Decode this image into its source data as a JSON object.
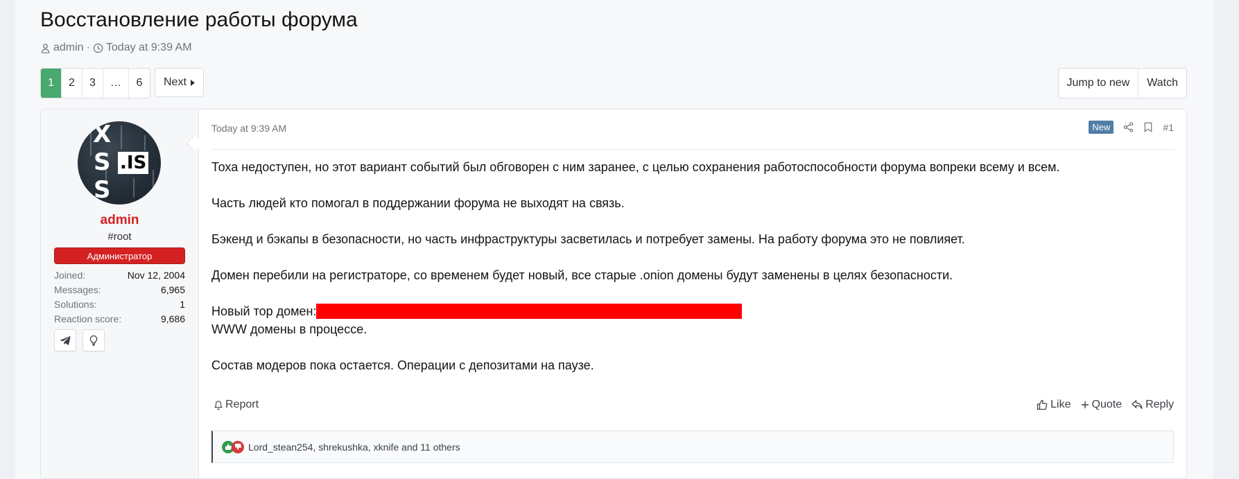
{
  "thread": {
    "title": "Восстановление работы форума",
    "author": "admin",
    "separator": "·",
    "date": "Today at 9:39 AM"
  },
  "pagination": {
    "pages": [
      "1",
      "2",
      "3",
      "…",
      "6"
    ],
    "active_page": "1",
    "next_label": "Next"
  },
  "top_actions": {
    "jump_label": "Jump to new",
    "watch_label": "Watch"
  },
  "user": {
    "avatar_letters": [
      "X",
      "S",
      "S"
    ],
    "avatar_badge": ".IS",
    "name": "admin",
    "title": "#root",
    "banner": "Администратор",
    "stats": [
      {
        "label": "Joined:",
        "value": "Nov 12, 2004"
      },
      {
        "label": "Messages:",
        "value": "6,965"
      },
      {
        "label": "Solutions:",
        "value": "1"
      },
      {
        "label": "Reaction score:",
        "value": "9,686"
      }
    ],
    "contacts": [
      "telegram-icon",
      "lightbulb-icon"
    ]
  },
  "post": {
    "date": "Today at 9:39 AM",
    "new_badge": "New",
    "number": "#1",
    "paragraphs": [
      "Тоха недоступен, но этот вариант событий был обговорен с ним заранее, с целью сохранения работоспособности форума вопреки всему и всем.",
      "Часть людей кто помогал в поддержании форума не выходят на связь.",
      "Бэкенд и бэкапы в безопасности, но часть инфраструктуры засветилась и потребует замены. На работу форума это не повлияет.",
      "Домен перебили на регистраторе, со временем будет новый, все старые .onion домены будут заменены в целях безопасности."
    ],
    "tor_label": "Новый тор домен:",
    "www_line": "WWW домены в процессе.",
    "last_paragraph": "Состав модеров пока остается. Операции с депозитами на паузе.",
    "report_label": "Report",
    "like_label": "Like",
    "quote_label": "Quote",
    "reply_label": "Reply",
    "reactions_text": "Lord_stean254, shrekushka, xknife and 11 others"
  },
  "colors": {
    "accent_green": "#47a96e",
    "admin_red": "#d42222",
    "new_badge": "#4f7ea6",
    "redaction": "#ff0000"
  }
}
